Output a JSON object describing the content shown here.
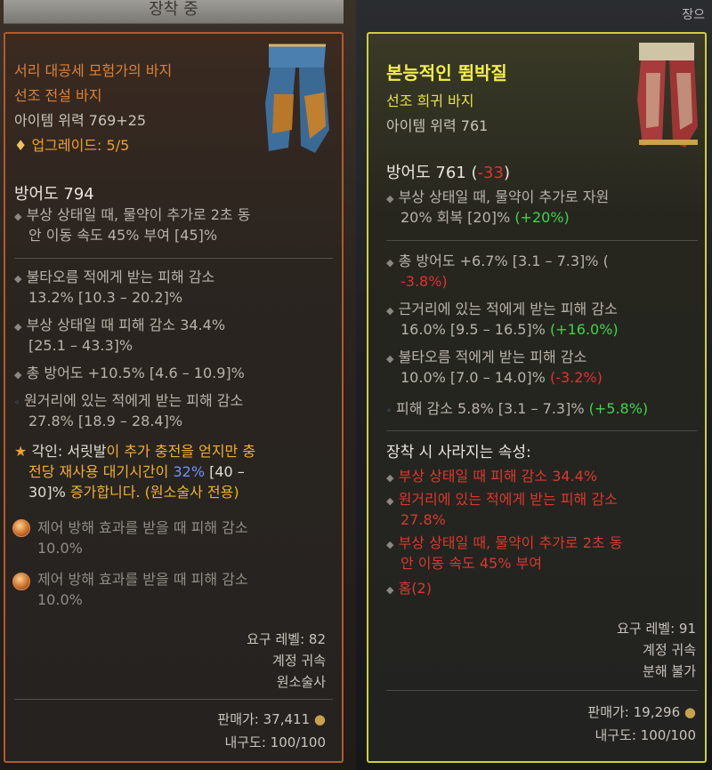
{
  "header": {
    "equipped_label": "장착 중",
    "right_label": "장으"
  },
  "left": {
    "name": "서리 대공세 모험가의 바지",
    "type": "선조 전설 바지",
    "power": "아이템 위력 769+25",
    "upgrade": "업그레이드: 5/5",
    "armor": "방어도 794",
    "implicit_1": "부상 상태일 때, 물약이 추가로 2초 동",
    "implicit_2": "안 이동 속도 45% 부여 [45]%",
    "affixes": [
      {
        "l1": "불타오름 적에게 받는 피해 감소",
        "l2": "13.2% [10.3 – 20.2]%"
      },
      {
        "l1": "부상 상태일 때 피해 감소 34.4%",
        "l2": "[25.1 – 43.3]%"
      },
      {
        "l1": "총 방어도 +10.5% [4.6 – 10.9]%",
        "l2": ""
      },
      {
        "l1": "원거리에 있는 적에게 받는 피해 감소",
        "l2": "27.8% [18.9 – 28.4]%"
      }
    ],
    "aspect": {
      "prefix": "각인: ",
      "w1": "서릿발",
      "y1": "이 추가 충전을 얻지만 충",
      "y2": "전당 재사용 대기시간이 ",
      "b2": "32%",
      "w2": " [40 –",
      "w3": "30]%",
      "y3": " 증가합니다. (원소술사 전용)"
    },
    "sockets": [
      {
        "l1": "제어 방해 효과를 받을 때 피해 감소",
        "l2": "10.0%"
      },
      {
        "l1": "제어 방해 효과를 받을 때 피해 감소",
        "l2": "10.0%"
      }
    ],
    "req_level": "요구 레벨: 82",
    "bound": "계정 귀속",
    "class": "원소술사",
    "sell": "판매가: 37,411",
    "durability": "내구도: 100/100"
  },
  "right": {
    "name": "본능적인 뜀박질",
    "type": "선조 희귀 바지",
    "power": "아이템 위력 761",
    "armor": "방어도 761",
    "armor_diff": "-33",
    "implicit_1": "부상 상태일 때, 물약이 추가로 자원",
    "implicit_2a": "20% 회복 [20]% ",
    "implicit_2b": "(+20%)",
    "affixes": [
      {
        "l1": "총 방어도 +6.7% [3.1 – 7.3]% (",
        "l2a": "",
        "l2b": "-3.8%)",
        "l2c": "",
        "kind": "neg2"
      },
      {
        "l1": "근거리에 있는 적에게 받는 피해 감소",
        "l2a": "16.0% [9.5 – 16.5]% ",
        "l2b": "(+16.0%)",
        "kind": "pos"
      },
      {
        "l1": "불타오름 적에게 받는 피해 감소",
        "l2a": "10.0% [7.0 – 14.0]% ",
        "l2b": "(-3.2%)",
        "kind": "neg"
      }
    ],
    "affix_last": {
      "a": "피해 감소 5.8% [3.1 – 7.3]% ",
      "b": "(+5.8%)"
    },
    "lost_title": "장착 시 사라지는 속성:",
    "lost": [
      "부상 상태일 때 피해 감소 34.4%",
      "원거리에 있는 적에게 받는 피해 감소",
      "27.8%",
      "부상 상태일 때, 물약이 추가로 2초 동",
      "안 이동 속도 45% 부여",
      "홈(2)"
    ],
    "req_level": "요구 레벨: 91",
    "bound": "계정 귀속",
    "salvage": "분해 불가",
    "sell": "판매가: 19,296",
    "durability": "내구도: 100/100"
  },
  "colors": {
    "legendary": "#d9823a",
    "rare": "#f2ee4a",
    "positive": "#3fd44a",
    "negative": "#e03232",
    "lost": "#d83a2e"
  }
}
